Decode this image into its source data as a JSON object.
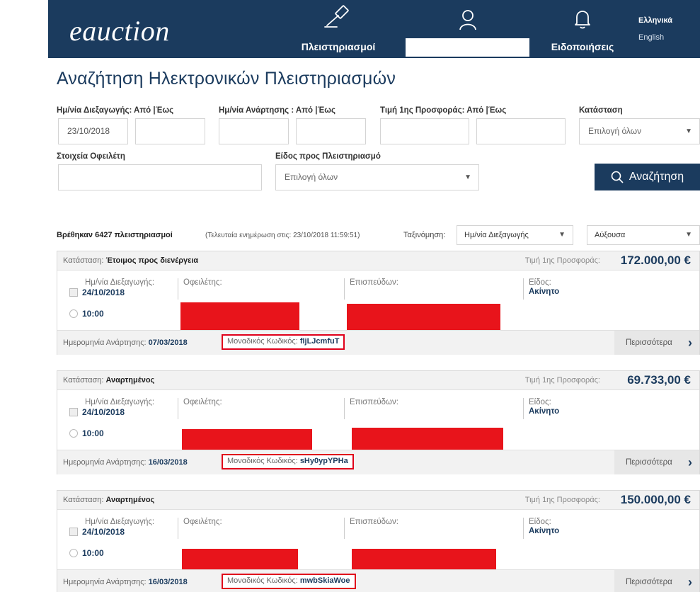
{
  "header": {
    "logo": "eauction",
    "nav_auctions": "Πλειστηριασμοί",
    "nav_notifications": "Ειδοποιήσεις",
    "lang_el": "Ελληνικά",
    "lang_en": "English"
  },
  "page_title": "Αναζήτηση Ηλεκτρονικών Πλειστηριασμών",
  "filters": {
    "conduct_date_label": "Ημ/νία Διεξαγωγής: Από |Έως",
    "conduct_date_from": "23/10/2018",
    "conduct_date_to": "",
    "posting_date_label": "Ημ/νία Ανάρτησης : Από |Έως",
    "first_offer_label": "Τιμή 1ης Προσφοράς: Από |Έως",
    "status_label": "Κατάσταση",
    "status_value": "Επιλογή όλων",
    "debtor_label": "Στοιχεία Οφειλέτη",
    "type_label": "Είδος προς Πλειστηριασμό",
    "type_value": "Επιλογή όλων",
    "search_button": "Αναζήτηση"
  },
  "results": {
    "count_text": "Βρέθηκαν 6427 πλειστηριασμοί",
    "updated_text": "(Τελευταία ενημέρωση στις: 23/10/2018 11:59:51)",
    "sort_label": "Ταξινόμηση:",
    "sort_field": "Ημ/νία Διεξαγωγής",
    "sort_order": "Αύξουσα"
  },
  "card_labels": {
    "status": "Κατάσταση:",
    "price": "Τιμή 1ης Προσφοράς:",
    "conduct_date": "Ημ/νία Διεξαγωγής:",
    "debtor": "Οφειλέτης:",
    "pursuer": "Επισπεύδων:",
    "type": "Είδος:",
    "posted": "Ημερομηνία Ανάρτησης:",
    "code": "Μοναδικός Κωδικός:",
    "more": "Περισσότερα"
  },
  "auctions": [
    {
      "status": "Έτοιμος προς διενέργεια",
      "price": "172.000,00 €",
      "date": "24/10/2018",
      "time": "10:00",
      "type": "Ακίνητο",
      "posted": "07/03/2018",
      "code": "fIjLJcmfuT"
    },
    {
      "status": "Αναρτημένος",
      "price": "69.733,00 €",
      "date": "24/10/2018",
      "time": "10:00",
      "type": "Ακίνητο",
      "posted": "16/03/2018",
      "code": "sHy0ypYPHa"
    },
    {
      "status": "Αναρτημένος",
      "price": "150.000,00 €",
      "date": "24/10/2018",
      "time": "10:00",
      "type": "Ακίνητο",
      "posted": "16/03/2018",
      "code": "mwbSkiaWoe"
    }
  ]
}
